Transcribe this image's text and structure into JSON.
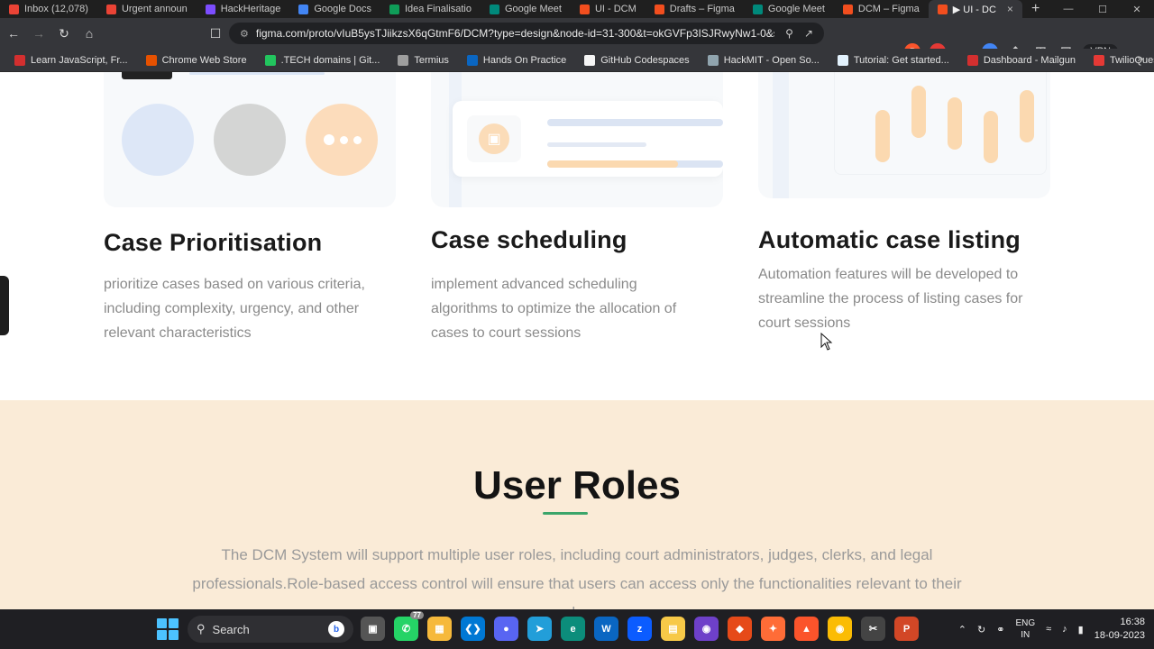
{
  "browser": {
    "tabs": [
      {
        "label": "Inbox (12,078)",
        "color": "#ea4335"
      },
      {
        "label": "Urgent announ",
        "color": "#ea4335"
      },
      {
        "label": "HackHeritage",
        "color": "#7c4dff"
      },
      {
        "label": "Google Docs",
        "color": "#4285f4"
      },
      {
        "label": "Idea Finalisatio",
        "color": "#0f9d58"
      },
      {
        "label": "Google Meet",
        "color": "#00897b"
      },
      {
        "label": "UI - DCM",
        "color": "#f24e1e"
      },
      {
        "label": "Drafts – Figma",
        "color": "#f24e1e"
      },
      {
        "label": "Google Meet",
        "color": "#00897b"
      },
      {
        "label": "DCM – Figma",
        "color": "#f24e1e"
      },
      {
        "label": "▶ UI - DC",
        "color": "#f24e1e",
        "active": true
      }
    ],
    "url": "figma.com/proto/vIuB5ysTJiikzsX6qGtmF6/DCM?type=design&node-id=31-300&t=okGVFp3ISJRwyNw1-0&scaling...",
    "vpn_label": "VPN",
    "bookmarks": [
      {
        "label": "Learn JavaScript, Fr...",
        "color": "#d32f2f"
      },
      {
        "label": "Chrome Web Store",
        "color": "#e65100"
      },
      {
        "label": ".TECH domains | Git...",
        "color": "#22c55e"
      },
      {
        "label": "Termius",
        "color": "#9e9e9e"
      },
      {
        "label": "Hands On Practice",
        "color": "#0a66c2"
      },
      {
        "label": "GitHub Codespaces",
        "color": "#f5f5f5"
      },
      {
        "label": "HackMIT - Open So...",
        "color": "#90a4ae"
      },
      {
        "label": "Tutorial: Get started...",
        "color": "#e3f2fd"
      },
      {
        "label": "Dashboard - Mailgun",
        "color": "#d32f2f"
      },
      {
        "label": "TwilioQuest - GitHu...",
        "color": "#e53935"
      }
    ]
  },
  "features": [
    {
      "title": "Case Prioritisation",
      "desc": " prioritize cases based on various criteria, including complexity, urgency, and other relevant characteristics"
    },
    {
      "title": "Case scheduling",
      "desc": "implement advanced scheduling algorithms to optimize the allocation of cases to court sessions"
    },
    {
      "title": "Automatic case listing",
      "desc": "Automation features will be developed to streamline the process of listing cases for court sessions"
    }
  ],
  "roles": {
    "title": "User Roles",
    "text": "The DCM System will support multiple user roles, including court administrators, judges, clerks, and legal professionals.Role-based access control will ensure that users can access only the functionalities relevant to their roles."
  },
  "taskbar": {
    "search_label": "Search",
    "whatsapp_badge": "77",
    "lang_top": "ENG",
    "lang_bottom": "IN",
    "time": "16:38",
    "date": "18-09-2023"
  }
}
